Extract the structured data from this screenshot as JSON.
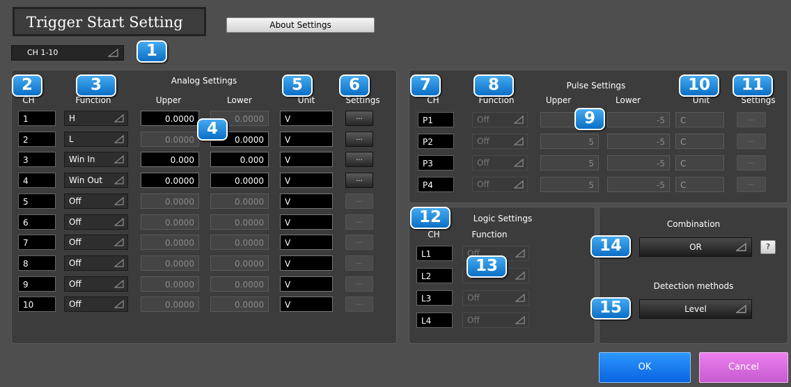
{
  "window": {
    "title": "Trigger Start Setting",
    "about_label": "About Settings"
  },
  "channel_group": {
    "selected": "CH 1-10"
  },
  "badges": [
    "1",
    "2",
    "3",
    "4",
    "5",
    "6",
    "7",
    "8",
    "9",
    "10",
    "11",
    "12",
    "13",
    "14",
    "15"
  ],
  "analog": {
    "title": "Analog Settings",
    "headers": {
      "ch": "CH",
      "function": "Function",
      "upper": "Upper",
      "lower": "Lower",
      "unit": "Unit",
      "settings": "Settings"
    },
    "rows": [
      {
        "ch": "1",
        "function": "H",
        "upper": "0.0000",
        "lower": "0.0000",
        "unit": "V",
        "settings": "...",
        "upper_on": true,
        "lower_on": false,
        "enabled": true
      },
      {
        "ch": "2",
        "function": "L",
        "upper": "0.0000",
        "lower": "0.0000",
        "unit": "V",
        "settings": "...",
        "upper_on": false,
        "lower_on": true,
        "enabled": true
      },
      {
        "ch": "3",
        "function": "Win In",
        "upper": "0.000",
        "lower": "0.000",
        "unit": "V",
        "settings": "...",
        "upper_on": true,
        "lower_on": true,
        "enabled": true
      },
      {
        "ch": "4",
        "function": "Win Out",
        "upper": "0.0000",
        "lower": "0.0000",
        "unit": "V",
        "settings": "...",
        "upper_on": true,
        "lower_on": true,
        "enabled": true
      },
      {
        "ch": "5",
        "function": "Off",
        "upper": "0.0000",
        "lower": "0.0000",
        "unit": "V",
        "settings": "...",
        "upper_on": false,
        "lower_on": false,
        "enabled": false
      },
      {
        "ch": "6",
        "function": "Off",
        "upper": "0.0000",
        "lower": "0.0000",
        "unit": "V",
        "settings": "...",
        "upper_on": false,
        "lower_on": false,
        "enabled": false
      },
      {
        "ch": "7",
        "function": "Off",
        "upper": "0.0000",
        "lower": "0.0000",
        "unit": "V",
        "settings": "...",
        "upper_on": false,
        "lower_on": false,
        "enabled": false
      },
      {
        "ch": "8",
        "function": "Off",
        "upper": "0.0000",
        "lower": "0.0000",
        "unit": "V",
        "settings": "...",
        "upper_on": false,
        "lower_on": false,
        "enabled": false
      },
      {
        "ch": "9",
        "function": "Off",
        "upper": "0.0000",
        "lower": "0.0000",
        "unit": "V",
        "settings": "...",
        "upper_on": false,
        "lower_on": false,
        "enabled": false
      },
      {
        "ch": "10",
        "function": "Off",
        "upper": "0.0000",
        "lower": "0.0000",
        "unit": "V",
        "settings": "...",
        "upper_on": false,
        "lower_on": false,
        "enabled": false
      }
    ]
  },
  "pulse": {
    "title": "Pulse Settings",
    "headers": {
      "ch": "CH",
      "function": "Function",
      "upper": "Upper",
      "lower": "Lower",
      "unit": "Unit",
      "settings": "Settings"
    },
    "rows": [
      {
        "ch": "P1",
        "function": "Off",
        "upper": "",
        "lower": "-5",
        "unit": "C",
        "settings": "..."
      },
      {
        "ch": "P2",
        "function": "Off",
        "upper": "5",
        "lower": "-5",
        "unit": "C",
        "settings": "..."
      },
      {
        "ch": "P3",
        "function": "Off",
        "upper": "5",
        "lower": "-5",
        "unit": "C",
        "settings": "..."
      },
      {
        "ch": "P4",
        "function": "Off",
        "upper": "5",
        "lower": "-5",
        "unit": "C",
        "settings": "..."
      }
    ]
  },
  "logic": {
    "title": "Logic Settings",
    "headers": {
      "ch": "CH",
      "function": "Function"
    },
    "rows": [
      {
        "ch": "L1",
        "function": "Off"
      },
      {
        "ch": "L2",
        "function": "Off"
      },
      {
        "ch": "L3",
        "function": "Off"
      },
      {
        "ch": "L4",
        "function": "Off"
      }
    ]
  },
  "combination": {
    "label": "Combination",
    "selected": "OR",
    "help": "?"
  },
  "detection": {
    "label": "Detection methods",
    "selected": "Level"
  },
  "footer": {
    "ok": "OK",
    "cancel": "Cancel"
  },
  "colors": {
    "badge": "#1682dc",
    "ok": "#1a7cf2",
    "cancel": "#d96ade",
    "background": "#4e4e4e"
  }
}
